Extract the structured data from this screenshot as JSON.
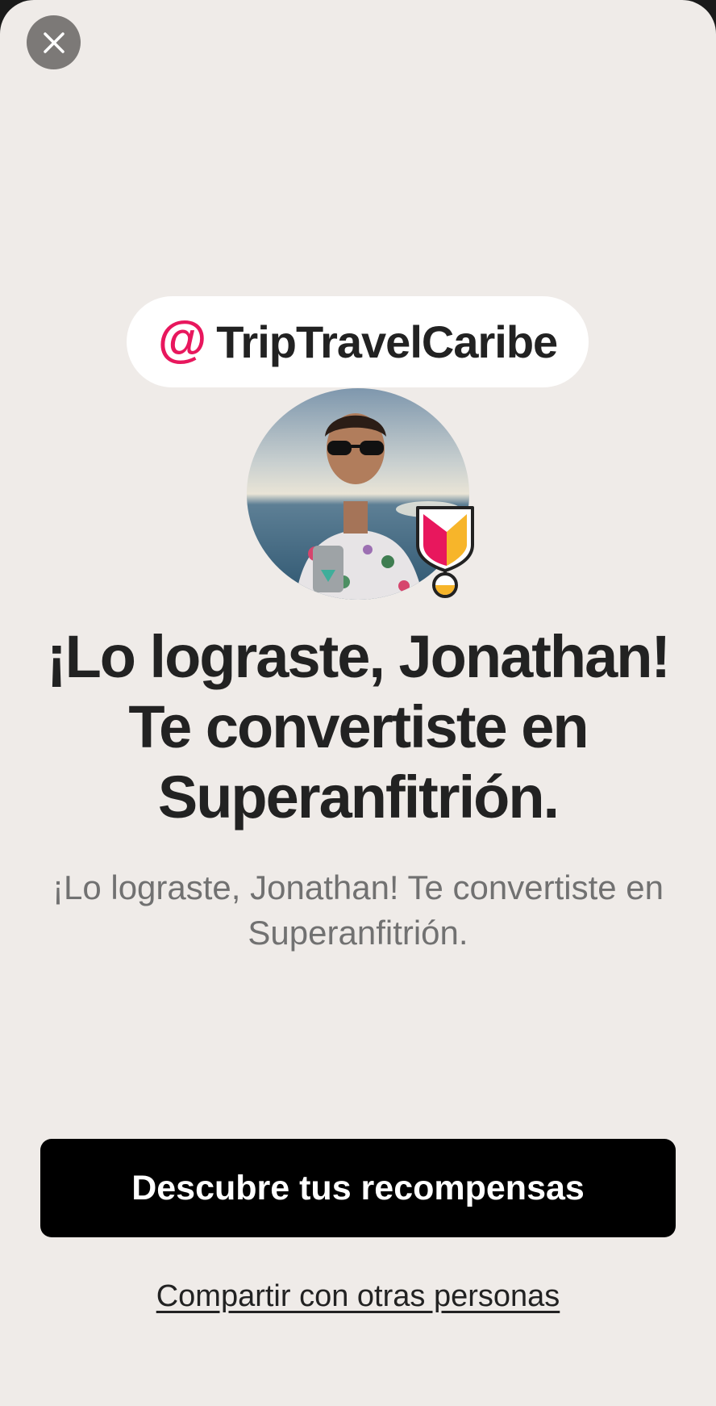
{
  "header": {
    "close_icon": "close-icon",
    "handle_prefix": "@",
    "handle": "TripTravelCaribe"
  },
  "profile": {
    "avatar": "host-photo",
    "badge_icon": "superhost-badge-icon"
  },
  "content": {
    "headline_line1": "¡Lo lograste, Jonathan!",
    "headline_line2": "Te convertiste en",
    "headline_line3": "Superanfitrión.",
    "subtext": "¡Lo lograste, Jonathan! Te convertiste en Superanfitrión."
  },
  "actions": {
    "primary_label": "Descubre tus recompensas",
    "share_label": "Compartir con otras personas"
  },
  "colors": {
    "background": "#efebe8",
    "brand_pink": "#e8175d",
    "badge_yellow": "#f7b52a",
    "button": "#000000"
  }
}
